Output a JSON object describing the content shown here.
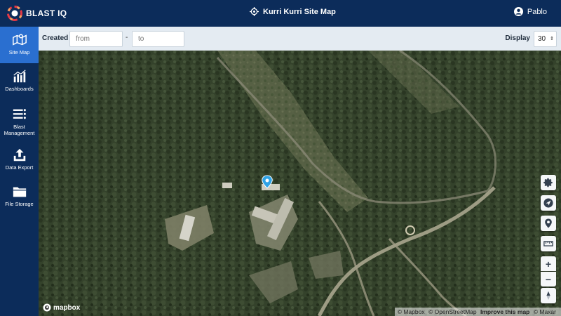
{
  "header": {
    "logo_text": "BLAST IQ",
    "site_title": "Kurri Kurri Site Map",
    "user_name": "Pablo"
  },
  "sidebar": {
    "items": [
      {
        "label": "Site Map",
        "icon": "map-icon",
        "active": true
      },
      {
        "label": "Dashboards",
        "icon": "bar-chart-icon",
        "active": false
      },
      {
        "label": "Blast Management",
        "icon": "list-icon",
        "active": false
      },
      {
        "label": "Data Export",
        "icon": "upload-icon",
        "active": false
      },
      {
        "label": "File Storage",
        "icon": "folder-icon",
        "active": false
      }
    ]
  },
  "filters": {
    "created_label": "Created",
    "from_placeholder": "from",
    "separator": "-",
    "to_placeholder": "to",
    "display_label": "Display",
    "display_value": "30"
  },
  "map": {
    "controls": [
      {
        "name": "settings-control",
        "icon": "gear-icon"
      },
      {
        "name": "navigate-control",
        "icon": "compass-arrow-icon"
      },
      {
        "name": "location-control",
        "icon": "location-pin-icon"
      },
      {
        "name": "measure-control",
        "icon": "ruler-icon"
      },
      {
        "name": "zoom-in-control",
        "label": "+"
      },
      {
        "name": "zoom-out-control",
        "label": "−"
      },
      {
        "name": "compass-control",
        "icon": "north-arrow-icon"
      }
    ],
    "logo_text": "mapbox",
    "attribution": {
      "mapbox": "© Mapbox",
      "osm": "© OpenStreetMap",
      "improve": "Improve this map",
      "maxar": "© Maxar"
    }
  },
  "colors": {
    "header_bg": "#0c2c5a",
    "active_nav": "#2a6fd0",
    "filter_bg": "#e4ebf2",
    "marker": "#2fa3e6"
  }
}
